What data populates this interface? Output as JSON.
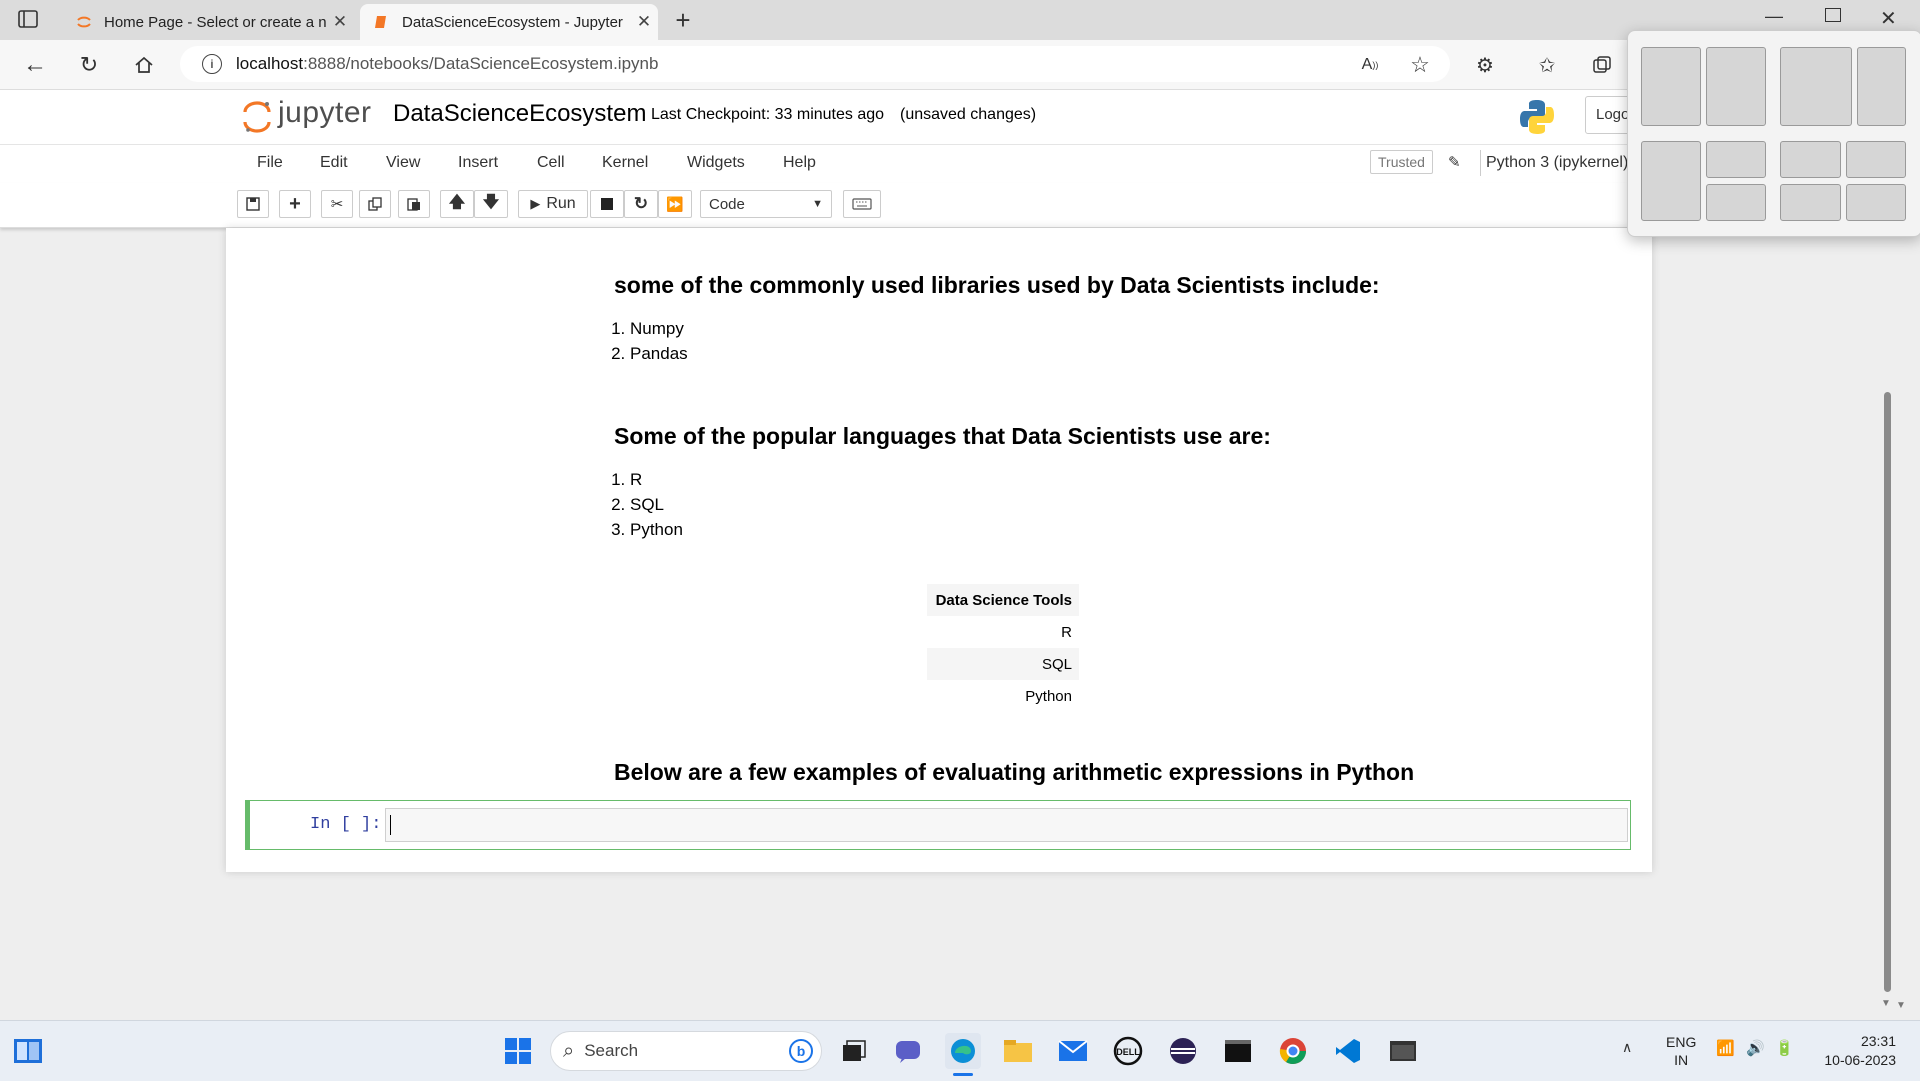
{
  "browser": {
    "tabs": [
      {
        "title": "Home Page - Select or create a n",
        "icon": "jupyter-icon"
      },
      {
        "title": "DataScienceEcosystem - Jupyter",
        "icon": "notebook-icon",
        "active": true
      }
    ],
    "url_host": "localhost",
    "url_rest": ":8888/notebooks/DataScienceEcosystem.ipynb"
  },
  "jupyter": {
    "logo_text": "jupyter",
    "notebook_name": "DataScienceEcosystem",
    "checkpoint": "Last Checkpoint: 33 minutes ago",
    "unsaved": "(unsaved changes)",
    "logout": "Logo",
    "menu": [
      "File",
      "Edit",
      "View",
      "Insert",
      "Cell",
      "Kernel",
      "Widgets",
      "Help"
    ],
    "trusted": "Trusted",
    "kernel": "Python 3 (ipykernel)",
    "run_label": "Run",
    "cell_type": "Code"
  },
  "notebook": {
    "heading_libraries": "some of the commonly used libraries used by Data Scientists include:",
    "libraries": [
      "Numpy",
      "Pandas"
    ],
    "heading_languages": "Some of the popular languages that Data Scientists use are:",
    "languages": [
      "R",
      "SQL",
      "Python"
    ],
    "table_header": "Data Science Tools",
    "table_rows": [
      "R",
      "SQL",
      "Python"
    ],
    "heading_arith": "Below are a few examples of evaluating arithmetic expressions in Python",
    "prompt": "In [ ]:"
  },
  "taskbar": {
    "search_placeholder": "Search",
    "lang_top": "ENG",
    "lang_bottom": "IN",
    "time": "23:31",
    "date": "10-06-2023"
  },
  "colors": {
    "cell_border": "#66bb6a",
    "prompt": "#303f9f",
    "jupyter_orange": "#f37726"
  }
}
